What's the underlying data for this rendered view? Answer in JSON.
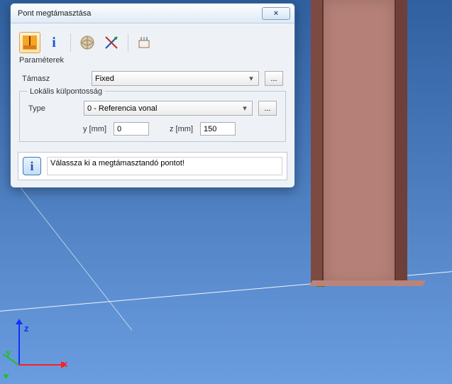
{
  "dialog": {
    "title": "Pont megtámasztása",
    "close_glyph": "×",
    "params_label": "Paraméterek",
    "support": {
      "label": "Támasz",
      "value": "Fixed",
      "more": "..."
    },
    "eccentricity": {
      "legend": "Lokális külpontosság",
      "type_label": "Type",
      "type_value": "0 - Referencia vonal",
      "type_more": "...",
      "y_label": "y [mm]",
      "y_value": "0",
      "z_label": "z [mm]",
      "z_value": "150"
    },
    "info_text": "Válassza ki a megtámasztandó pontot!"
  },
  "axes": {
    "x": "x",
    "y": "y",
    "z": "z"
  }
}
